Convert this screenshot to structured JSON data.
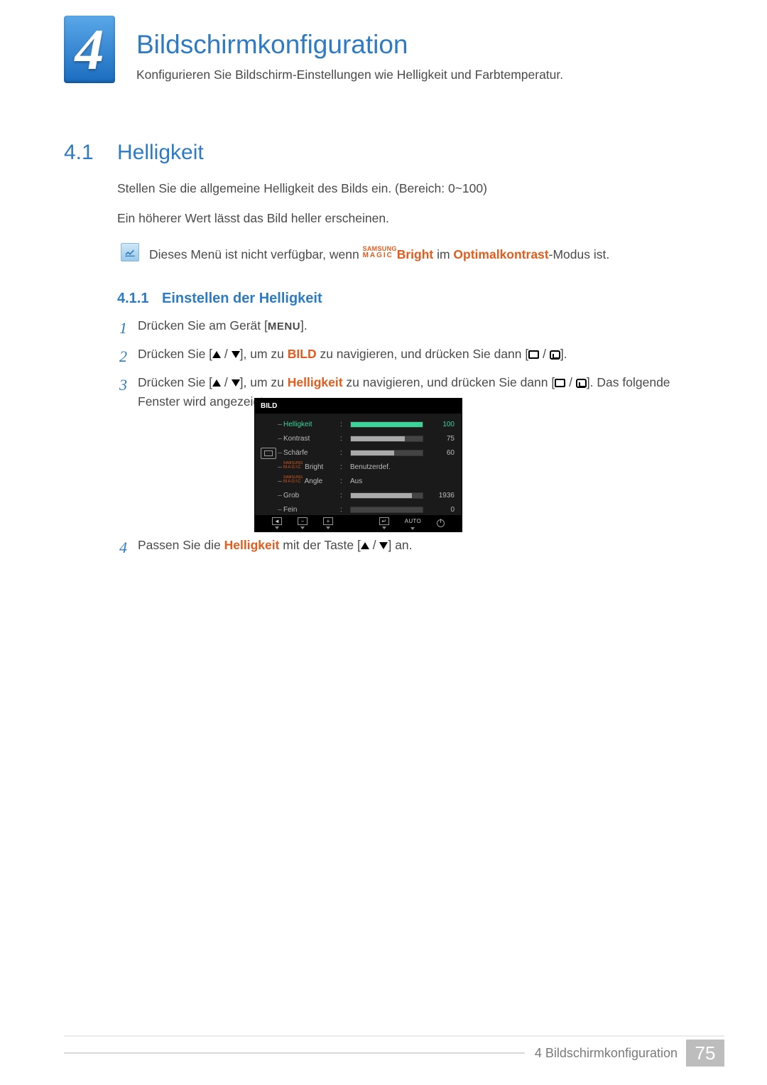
{
  "chapter": {
    "number": "4",
    "title": "Bildschirmkonfiguration",
    "intro": "Konfigurieren Sie Bildschirm-Einstellungen wie Helligkeit und Farbtemperatur."
  },
  "section": {
    "number": "4.1",
    "title": "Helligkeit",
    "p1": "Stellen Sie die allgemeine Helligkeit des Bilds ein. (Bereich: 0~100)",
    "p2": "Ein höherer Wert lässt das Bild heller erscheinen."
  },
  "note": {
    "pre": "Dieses Menü ist nicht verfügbar, wenn ",
    "brand_top": "SAMSUNG",
    "brand_bot": "MAGIC",
    "bright": "Bright",
    "mid": " im ",
    "opt": "Optimalkontrast",
    "post": "-Modus ist."
  },
  "subsection": {
    "number": "4.1.1",
    "title": "Einstellen der Helligkeit"
  },
  "steps": {
    "n1": "1",
    "n2": "2",
    "n3": "3",
    "n4": "4",
    "s1a": "Drücken Sie am Gerät [",
    "s1m": "MENU",
    "s1b": "].",
    "s2a": "Drücken Sie [",
    "s2b": "], um zu ",
    "s2bild": "BILD",
    "s2c": " zu navigieren, und drücken Sie dann [",
    "s2d": "].",
    "s3a": "Drücken Sie [",
    "s3b": "], um zu ",
    "s3hell": "Helligkeit",
    "s3c": " zu navigieren, und drücken Sie dann [",
    "s3d": "]. Das folgende Fenster wird angezeigt.",
    "s4a": "Passen Sie die ",
    "s4hell": "Helligkeit",
    "s4b": " mit der Taste [",
    "s4c": "] an."
  },
  "osd": {
    "title": "BILD",
    "rows": [
      {
        "label": "Helligkeit",
        "value": "100",
        "fill": 100,
        "active": true
      },
      {
        "label": "Kontrast",
        "value": "75",
        "fill": 75
      },
      {
        "label": "Schärfe",
        "value": "60",
        "fill": 60
      },
      {
        "label_brand": true,
        "label_tail": " Bright",
        "text": "Benutzerdef."
      },
      {
        "label_brand": true,
        "label_tail": " Angle",
        "text": "Aus"
      },
      {
        "label": "Grob",
        "value": "1936",
        "fill": 85
      },
      {
        "label": "Fein",
        "value": "0",
        "fill": 0
      }
    ],
    "footer_auto": "AUTO"
  },
  "footer": {
    "label": "4 Bildschirmkonfiguration",
    "page": "75"
  }
}
